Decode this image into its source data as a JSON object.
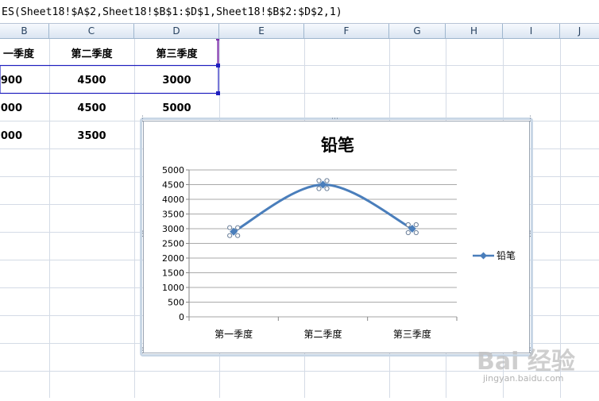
{
  "formula_bar": {
    "text": "ES(Sheet18!$A$2,Sheet18!$B$1:$D$1,Sheet18!$B$2:$D$2,1)"
  },
  "columns": [
    "B",
    "C",
    "D",
    "E",
    "F",
    "G",
    "H",
    "I",
    "J"
  ],
  "table": {
    "header": [
      "一季度",
      "第二季度",
      "第三季度"
    ],
    "rows": [
      [
        "900",
        "4500",
        "3000"
      ],
      [
        "000",
        "4500",
        "5000"
      ],
      [
        "000",
        "3500",
        ""
      ]
    ]
  },
  "colors": {
    "series": "#4a7ebb",
    "grid_lines": "#b7c7da",
    "selection": "#1f1fbf",
    "range_marker": "#7a2aa8"
  },
  "chart_data": {
    "type": "line",
    "title": "铅笔",
    "categories": [
      "第一季度",
      "第二季度",
      "第三季度"
    ],
    "series": [
      {
        "name": "铅笔",
        "values": [
          2900,
          4500,
          3000
        ]
      }
    ],
    "yticks": [
      "0",
      "500",
      "1000",
      "1500",
      "2000",
      "2500",
      "3000",
      "3500",
      "4000",
      "4500",
      "5000"
    ],
    "ylim": [
      0,
      5000
    ],
    "smooth": true,
    "grid": true,
    "legend": "right"
  },
  "watermark": {
    "main": "Bai 经验",
    "sub": "jingyan.baidu.com"
  }
}
